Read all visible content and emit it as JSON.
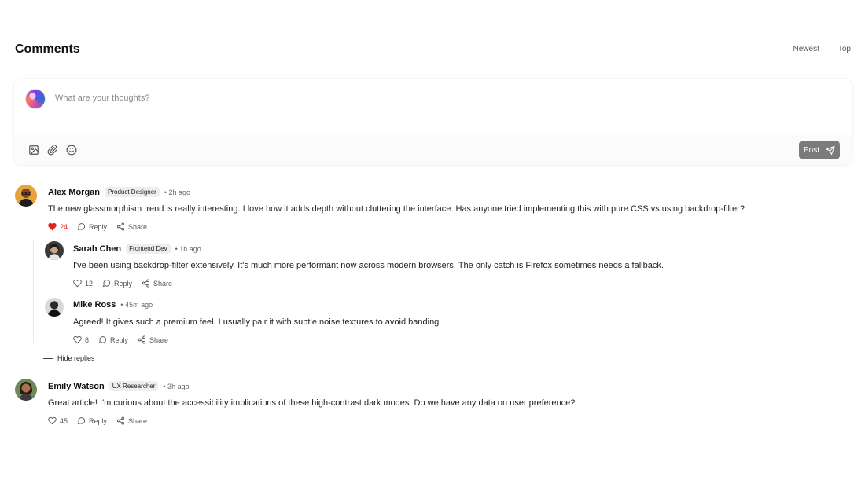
{
  "header": {
    "title": "Comments",
    "sort_options": [
      "Newest",
      "Top"
    ]
  },
  "composer": {
    "placeholder": "What are your thoughts?",
    "post_label": "Post"
  },
  "comments": [
    {
      "author": "Alex Morgan",
      "badge": "Product Designer",
      "time": "• 2h ago",
      "text": "The new glassmorphism trend is really interesting. I love how it adds depth without cluttering the interface. Has anyone tried implementing this with pure CSS vs using backdrop-filter?",
      "likes": "24",
      "reply_label": "Reply",
      "share_label": "Share",
      "replies": [
        {
          "author": "Sarah Chen",
          "badge": "Frontend Dev",
          "time": "• 1h ago",
          "text": "I've been using backdrop-filter extensively. It's much more performant now across modern browsers. The only catch is Firefox sometimes needs a fallback.",
          "likes": "12",
          "reply_label": "Reply",
          "share_label": "Share"
        },
        {
          "author": "Mike Ross",
          "time": "• 45m ago",
          "text": "Agreed! It gives such a premium feel. I usually pair it with subtle noise textures to avoid banding.",
          "likes": "8",
          "reply_label": "Reply",
          "share_label": "Share"
        }
      ],
      "hide_replies_label": "Hide replies"
    },
    {
      "author": "Emily Watson",
      "badge": "UX Researcher",
      "time": "• 3h ago",
      "text": "Great article! I'm curious about the accessibility implications of these high-contrast dark modes. Do we have any data on user preference?",
      "likes": "45",
      "reply_label": "Reply",
      "share_label": "Share"
    }
  ],
  "colors": {
    "like_active": "#e02424",
    "post_button": "#7b7b7b",
    "badge_bg": "#eeeeee"
  },
  "icons": [
    "image-icon",
    "paperclip-icon",
    "smile-icon",
    "send-icon",
    "heart-icon",
    "comment-icon",
    "share-icon"
  ]
}
